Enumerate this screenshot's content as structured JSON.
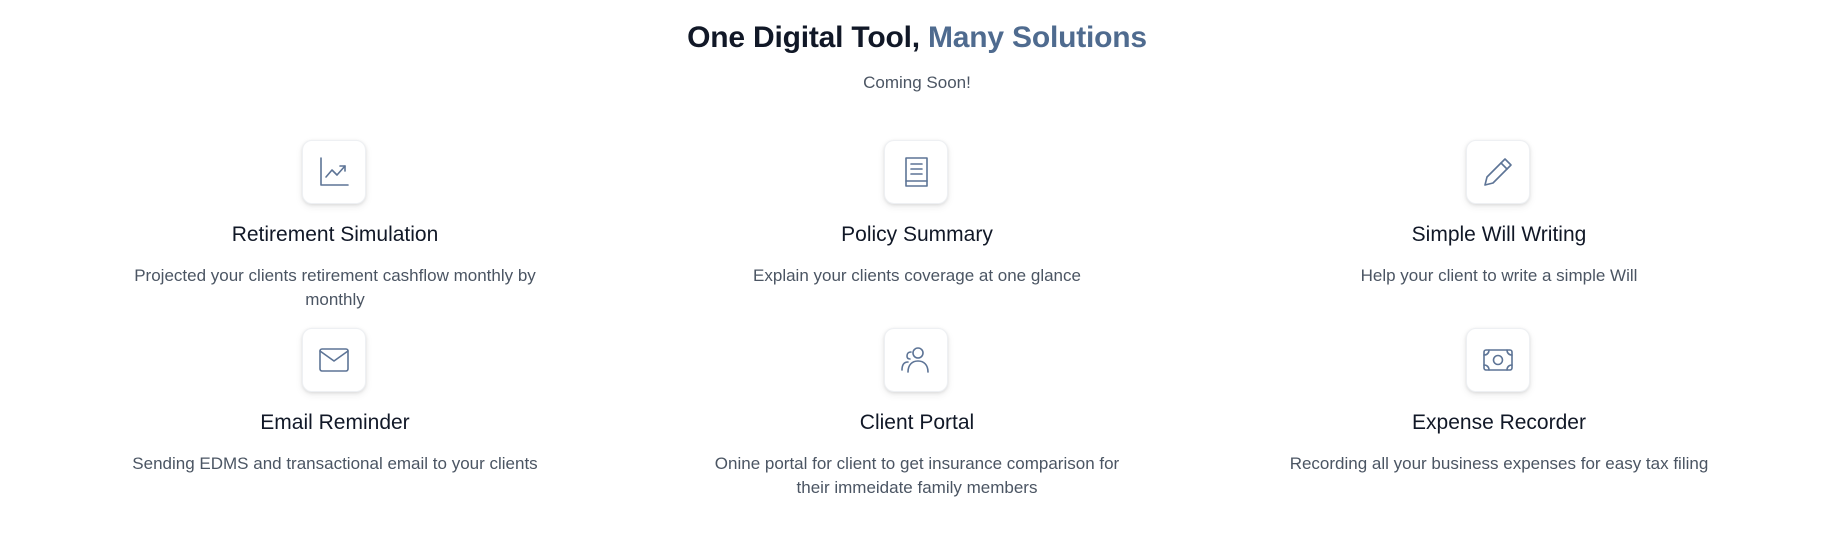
{
  "header": {
    "title_main": "One Digital Tool, ",
    "title_accent": "Many Solutions",
    "subtitle": "Coming Soon!"
  },
  "colors": {
    "accent": "#4f6b8f",
    "icon": "#5d7496",
    "title_text": "#111827",
    "body_text": "#4b5563"
  },
  "features": [
    {
      "icon": "chart-line-icon",
      "title": "Retirement Simulation",
      "description": "Projected your clients retirement cashflow monthly by monthly"
    },
    {
      "icon": "book-icon",
      "title": "Policy Summary",
      "description": "Explain your clients coverage at one glance"
    },
    {
      "icon": "pencil-icon",
      "title": "Simple Will Writing",
      "description": "Help your client to write a simple Will"
    },
    {
      "icon": "envelope-icon",
      "title": "Email Reminder",
      "description": "Sending EDMS and transactional email to your clients"
    },
    {
      "icon": "users-icon",
      "title": "Client Portal",
      "description": "Onine portal for client to get insurance comparison for their immeidate family members"
    },
    {
      "icon": "banknote-icon",
      "title": "Expense Recorder",
      "description": "Recording all your business expenses for easy tax filing"
    }
  ]
}
